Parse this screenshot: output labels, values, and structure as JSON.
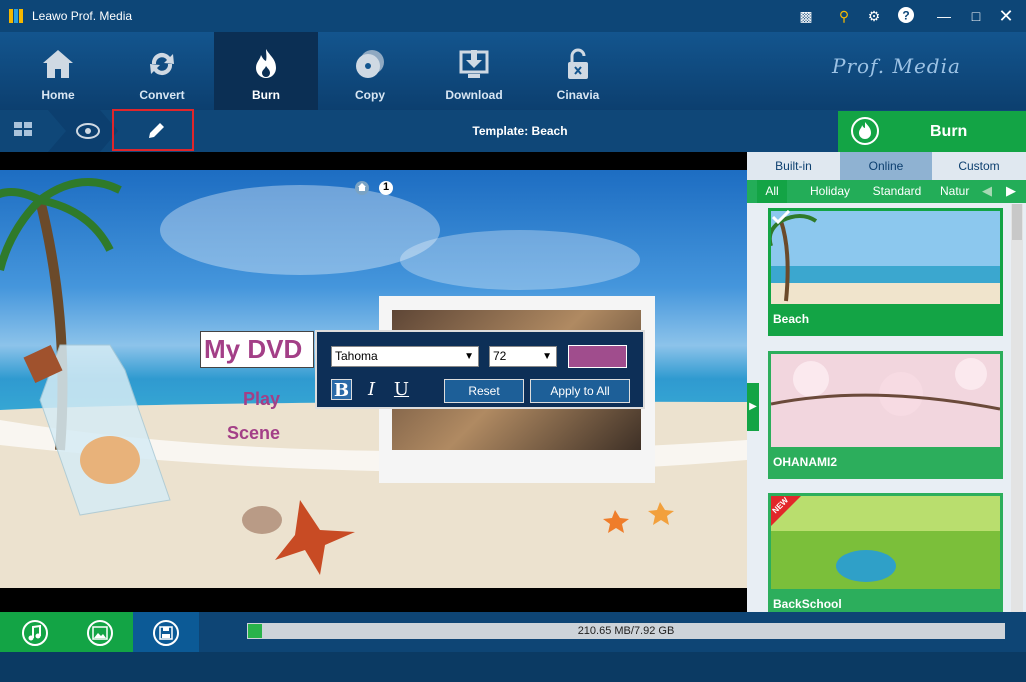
{
  "app": {
    "title": "Leawo Prof. Media",
    "brand": "Prof. Media"
  },
  "nav": {
    "home": "Home",
    "convert": "Convert",
    "burn": "Burn",
    "copy": "Copy",
    "download": "Download",
    "cinavia": "Cinavia",
    "active": "Burn"
  },
  "toolbar": {
    "template_label": "Template: Beach",
    "burn_button": "Burn"
  },
  "preview": {
    "page_number": "1",
    "dvd_title": "My DVD",
    "menu_items": [
      "Play",
      "Scene"
    ]
  },
  "font_toolbar": {
    "font_family": "Tahoma",
    "font_size": "72",
    "color": "#a04d8d",
    "bold": "B",
    "italic": "I",
    "underline": "U",
    "reset": "Reset",
    "apply_all": "Apply to All"
  },
  "templates_panel": {
    "tabs": [
      "Built-in",
      "Online",
      "Custom"
    ],
    "active_tab": "Online",
    "categories": [
      "All",
      "Holiday",
      "Standard",
      "Natur"
    ],
    "active_category": "All",
    "items": [
      {
        "name": "Beach",
        "selected": true,
        "badge": ""
      },
      {
        "name": "OHANAMI2",
        "selected": false,
        "badge": ""
      },
      {
        "name": "BackSchool",
        "selected": false,
        "badge": "NEW"
      }
    ]
  },
  "status": {
    "disc_usage": "210.65 MB/7.92 GB",
    "progress_fraction": 0.019
  },
  "colors": {
    "accent_green": "#13a445",
    "nav_blue": "#0c3f6f",
    "title_purple": "#a33f87"
  }
}
